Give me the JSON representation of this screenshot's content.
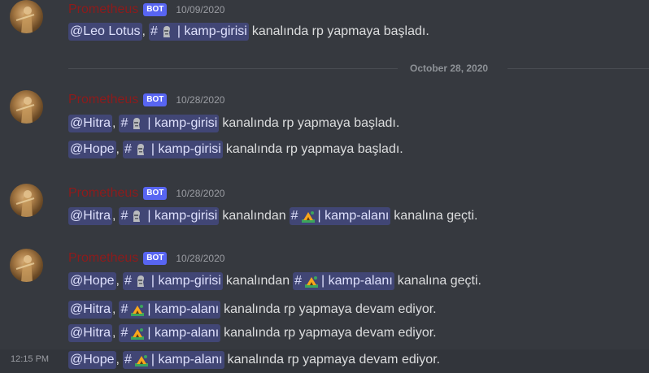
{
  "divider": {
    "label": "October 28, 2020"
  },
  "hover_time": "12:15 PM",
  "groups": [
    {
      "author": "Prometheus",
      "badge": "BOT",
      "timestamp": "10/09/2020",
      "lines": [
        {
          "user": "@Leo Lotus",
          "sep": ",",
          "ch1": "| kamp-girisi",
          "ch1_icon": "moai-icon",
          "mid": "kanalında rp yapmaya başladı."
        }
      ]
    },
    {
      "author": "Prometheus",
      "badge": "BOT",
      "timestamp": "10/28/2020",
      "lines": [
        {
          "user": "@Hitra",
          "sep": ",",
          "ch1": "| kamp-girisi",
          "ch1_icon": "moai-icon",
          "mid": "kanalında rp yapmaya başladı."
        },
        {
          "user": "@Hope",
          "sep": ",",
          "ch1": "| kamp-girisi",
          "ch1_icon": "moai-icon",
          "mid": "kanalında rp yapmaya başladı."
        }
      ]
    },
    {
      "author": "Prometheus",
      "badge": "BOT",
      "timestamp": "10/28/2020",
      "lines": [
        {
          "user": "@Hitra",
          "sep": ",",
          "ch1": "| kamp-girisi",
          "ch1_icon": "moai-icon",
          "mid": "kanalından",
          "ch2": "| kamp-alanı",
          "ch2_icon": "camp-icon",
          "end": "kanalına geçti."
        }
      ]
    },
    {
      "author": "Prometheus",
      "badge": "BOT",
      "timestamp": "10/28/2020",
      "lines": [
        {
          "user": "@Hope",
          "sep": ",",
          "ch1": "| kamp-girisi",
          "ch1_icon": "moai-icon",
          "mid": "kanalından",
          "ch2": "| kamp-alanı",
          "ch2_icon": "camp-icon",
          "end": "kanalına geçti."
        },
        {
          "user": "@Hitra",
          "sep": ",",
          "ch1": "| kamp-alanı",
          "ch1_icon": "camp-icon",
          "mid": "kanalında rp yapmaya devam ediyor."
        },
        {
          "user": "@Hitra",
          "sep": ",",
          "ch1": "| kamp-alanı",
          "ch1_icon": "camp-icon",
          "mid": "kanalında rp yapmaya devam ediyor."
        },
        {
          "user": "@Hope",
          "sep": ",",
          "ch1": "| kamp-alanı",
          "ch1_icon": "camp-icon",
          "mid": "kanalında rp yapmaya devam ediyor."
        }
      ]
    }
  ],
  "hash_symbol": "#",
  "colors": {
    "background": "#36393f",
    "author": "#8e1b1b",
    "mention_bg": "#414675",
    "bot_badge": "#5865f2"
  }
}
